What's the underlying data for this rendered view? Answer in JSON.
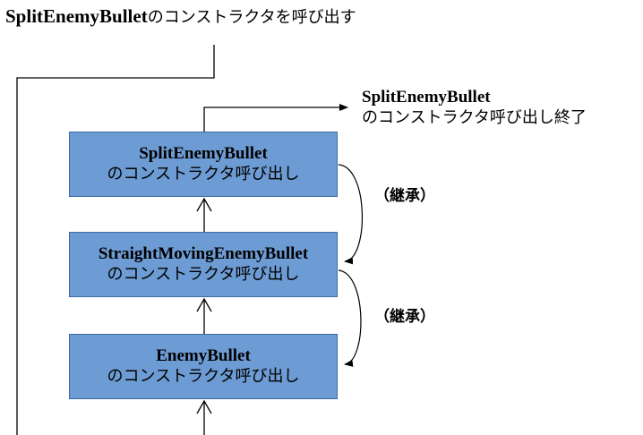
{
  "title": {
    "class_name": "SplitEnemyBullet",
    "suffix": "のコンストラクタを呼び出す"
  },
  "end_label": {
    "line1": "SplitEnemyBullet",
    "line2": "のコンストラクタ呼び出し終了"
  },
  "boxes": {
    "split": {
      "line1": "SplitEnemyBullet",
      "line2": "のコンストラクタ呼び出し"
    },
    "straight": {
      "line1": "StraightMovingEnemyBullet",
      "line2": "のコンストラクタ呼び出し"
    },
    "enemy": {
      "line1": "EnemyBullet",
      "line2": "のコンストラクタ呼び出し"
    }
  },
  "inheritance": {
    "first": "（継承）",
    "second": "（継承）"
  },
  "colors": {
    "box_fill": "#6d9bd3",
    "box_border": "#3b6aa3",
    "line": "#000000",
    "background": "#ffffff"
  }
}
